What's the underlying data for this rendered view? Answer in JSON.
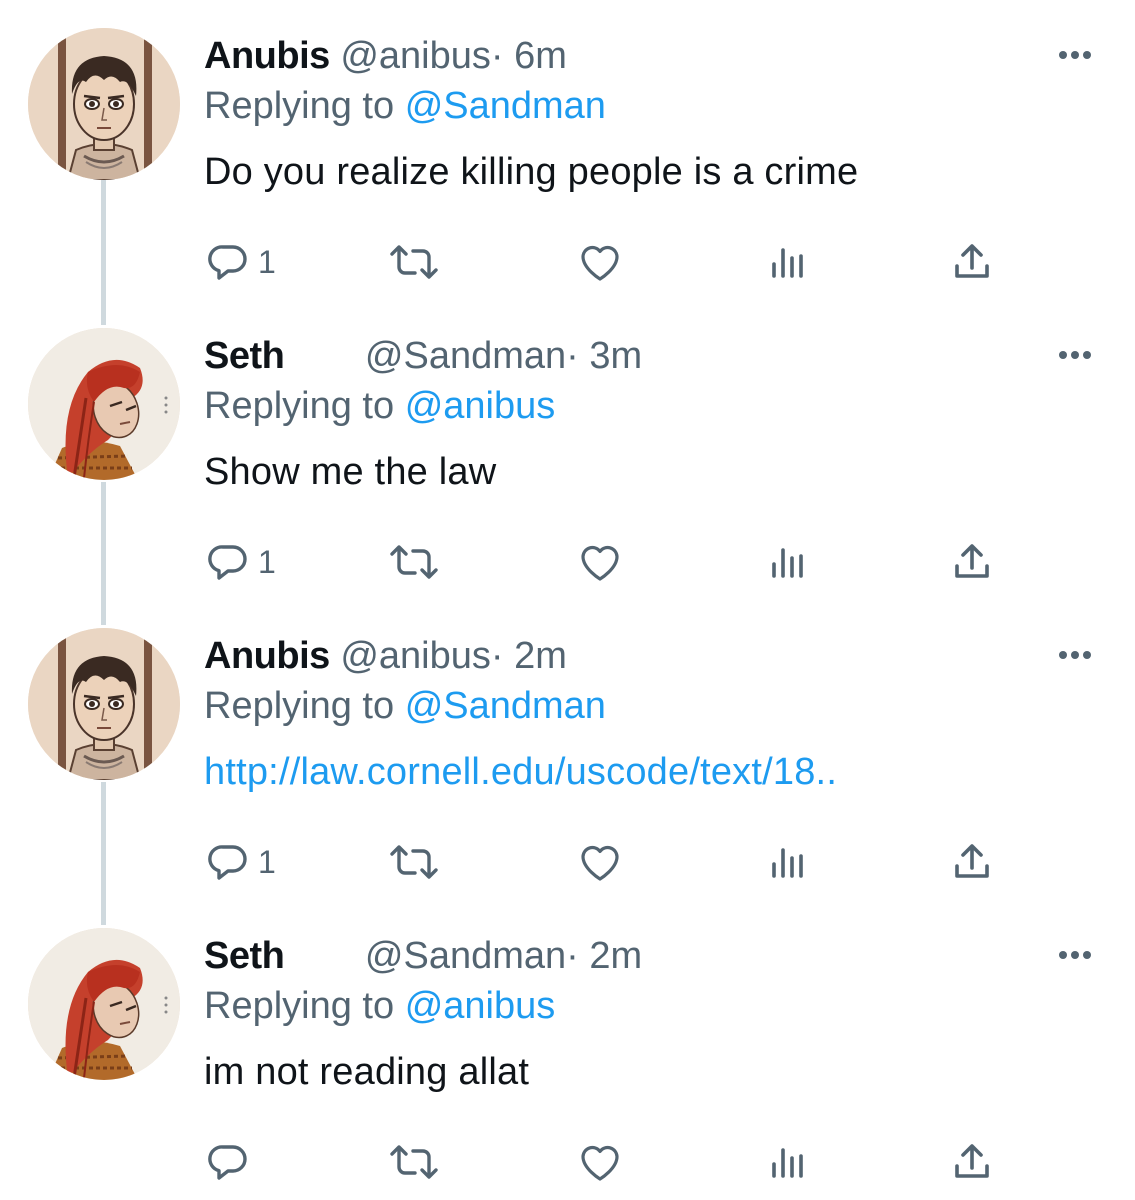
{
  "tweets": [
    {
      "name": "Anubis",
      "handle": "@anibus",
      "time": "· 6m",
      "reply_label": "Replying to",
      "reply_to": "@Sandman",
      "text": "Do you realize killing people is a crime",
      "text_is_link": false,
      "avatar": "anubis",
      "reply_count": "1"
    },
    {
      "name": "Seth",
      "handle": "@Sandman",
      "time": "· 3m",
      "reply_label": "Replying to",
      "reply_to": "@anibus",
      "text": "Show me the law",
      "text_is_link": false,
      "avatar": "seth",
      "reply_count": "1"
    },
    {
      "name": "Anubis",
      "handle": "@anibus",
      "time": "· 2m",
      "reply_label": "Replying to",
      "reply_to": "@Sandman",
      "text": "http://law.cornell.edu/uscode/text/18..",
      "text_is_link": true,
      "avatar": "anubis",
      "reply_count": "1"
    },
    {
      "name": "Seth",
      "handle": "@Sandman",
      "time": "· 2m",
      "reply_label": "Replying to",
      "reply_to": "@anibus",
      "text": "im not reading allat",
      "text_is_link": false,
      "avatar": "seth",
      "reply_count": ""
    }
  ],
  "icons": {
    "reply": "reply-icon",
    "retweet": "retweet-icon",
    "like": "heart-icon",
    "views": "analytics-icon",
    "share": "share-icon",
    "more": "more-icon"
  },
  "colors": {
    "text": "#0f1419",
    "muted": "#536471",
    "link": "#1d9bf0",
    "thread_line": "#cfd9de"
  }
}
